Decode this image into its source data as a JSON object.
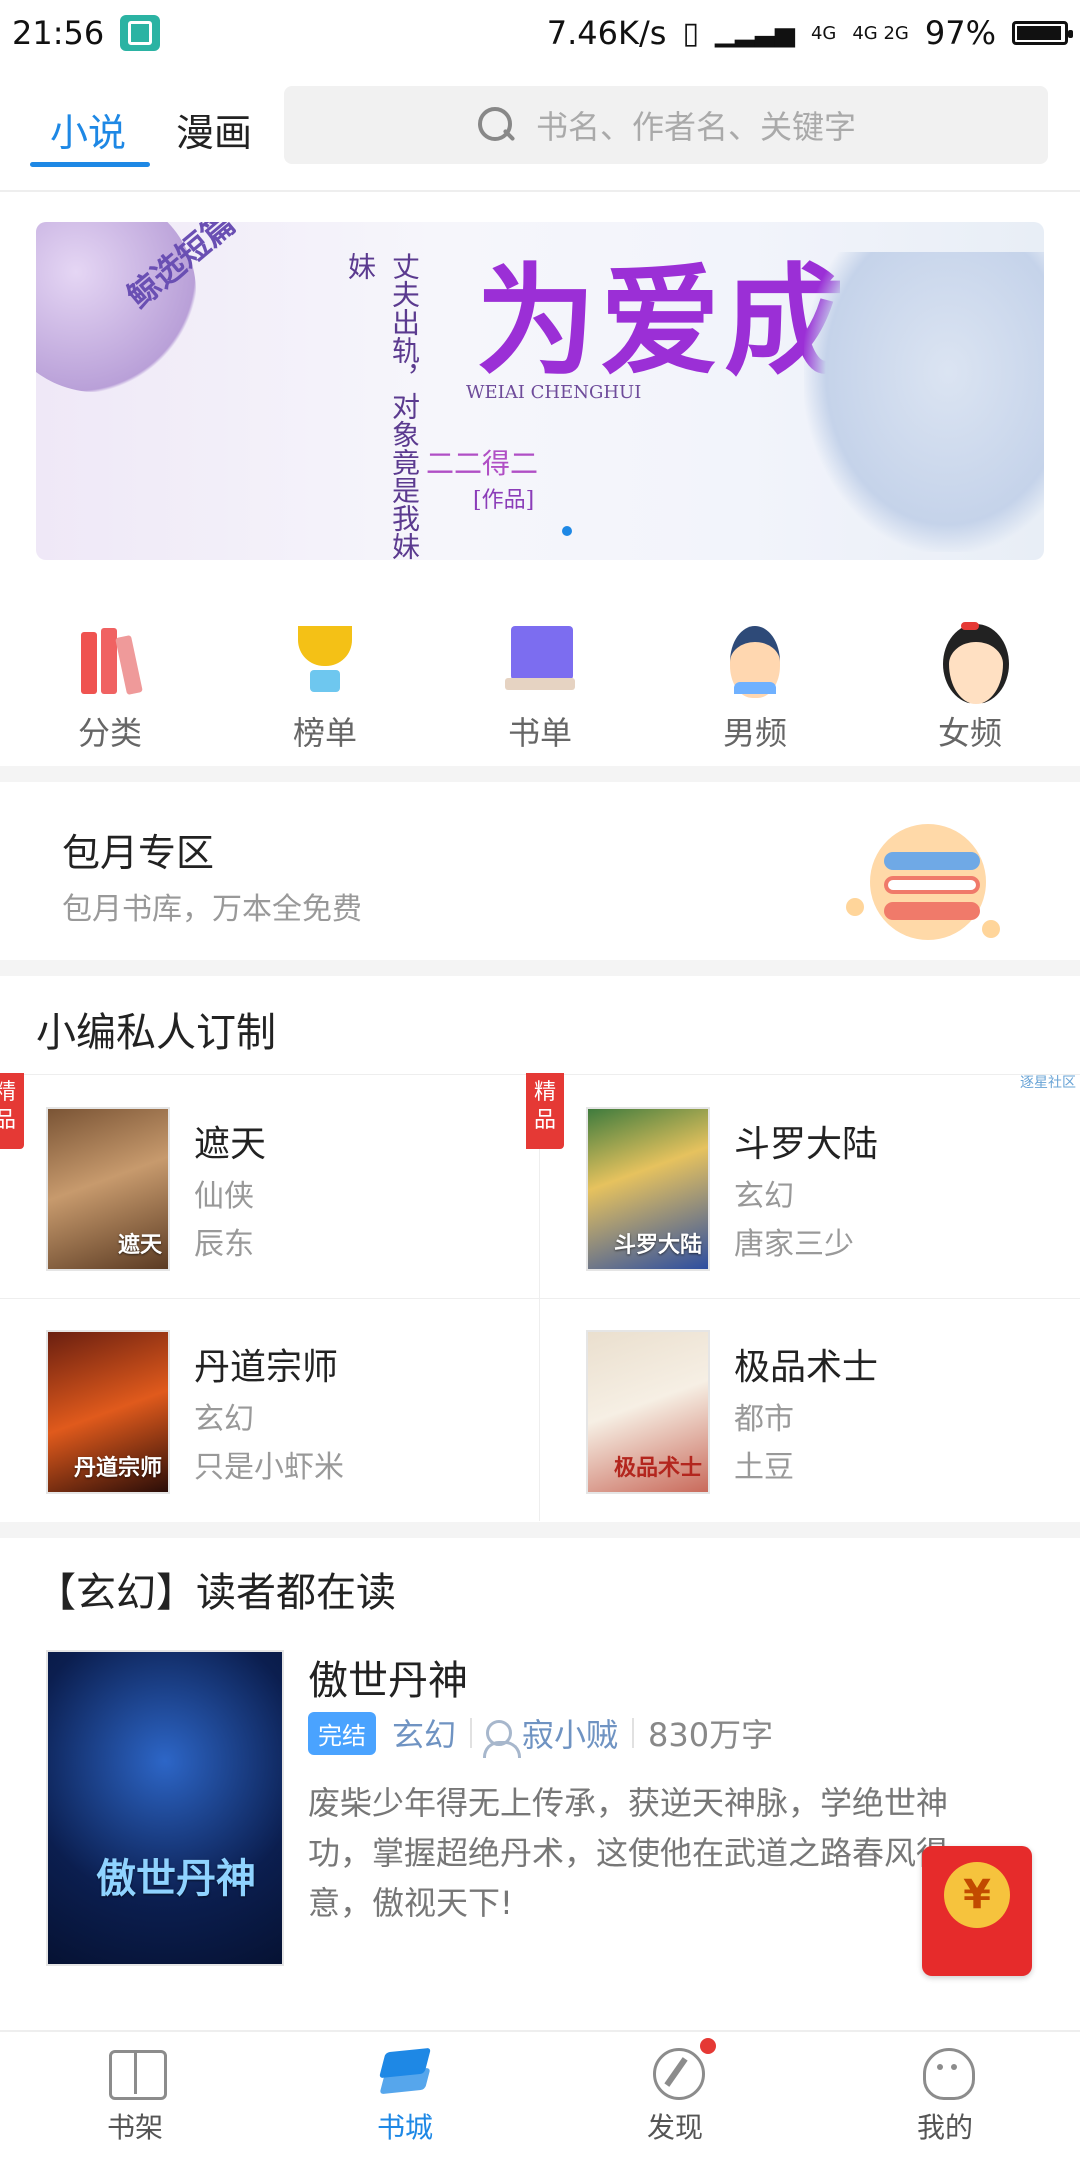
{
  "status": {
    "time": "21:56",
    "speed": "7.46K/s",
    "network1": "4G",
    "network2": "4G 2G",
    "battery": "97%"
  },
  "header": {
    "tabs": [
      "小说",
      "漫画"
    ],
    "search_placeholder": "书名、作者名、关键字"
  },
  "banner": {
    "ribbon": "鲸选短篇",
    "subtitle": "丈夫出轨，对象竟是我妹妹",
    "title": "为爱成灰",
    "pinyin": "WEIAI CHENGHUI",
    "author": "二二得二",
    "works": "[作品]"
  },
  "categories": [
    {
      "label": "分类",
      "icon": "books-icon"
    },
    {
      "label": "榜单",
      "icon": "trophy-icon"
    },
    {
      "label": "书单",
      "icon": "booklist-icon"
    },
    {
      "label": "男频",
      "icon": "boy-icon"
    },
    {
      "label": "女频",
      "icon": "girl-icon"
    }
  ],
  "monthly": {
    "title": "包月专区",
    "desc": "包月书库，万本全免费"
  },
  "curated": {
    "title": "小编私人订制",
    "ad_tag": "逐星社区",
    "items": [
      {
        "name": "遮天",
        "genre": "仙侠",
        "author": "辰东",
        "badge": "精品",
        "cover_text": "遮天"
      },
      {
        "name": "斗罗大陆",
        "genre": "玄幻",
        "author": "唐家三少",
        "badge": "精品",
        "cover_text": "斗罗大陆"
      },
      {
        "name": "丹道宗师",
        "genre": "玄幻",
        "author": "只是小虾米",
        "badge": "",
        "cover_text": "丹道宗师"
      },
      {
        "name": "极品术士",
        "genre": "都市",
        "author": "土豆",
        "badge": "",
        "cover_text": "极品术士"
      }
    ]
  },
  "featured": {
    "section_title": "【玄幻】读者都在读",
    "book": {
      "title": "傲世丹神",
      "status": "完结",
      "genre": "玄幻",
      "author": "寂小贼",
      "words": "830万字",
      "desc": "废柴少年得无上传承，获逆天神脉，学绝世神功，掌握超绝丹术，这使他在武道之路春风得意，傲视天下!",
      "cover_text": "傲世丹神"
    }
  },
  "redpacket": {
    "symbol": "¥"
  },
  "bottom_nav": [
    {
      "label": "书架",
      "icon": "shelf-icon"
    },
    {
      "label": "书城",
      "icon": "store-icon"
    },
    {
      "label": "发现",
      "icon": "discover-icon"
    },
    {
      "label": "我的",
      "icon": "mine-icon"
    }
  ],
  "colors": {
    "accent": "#1e88e5",
    "badge": "#e53935"
  }
}
